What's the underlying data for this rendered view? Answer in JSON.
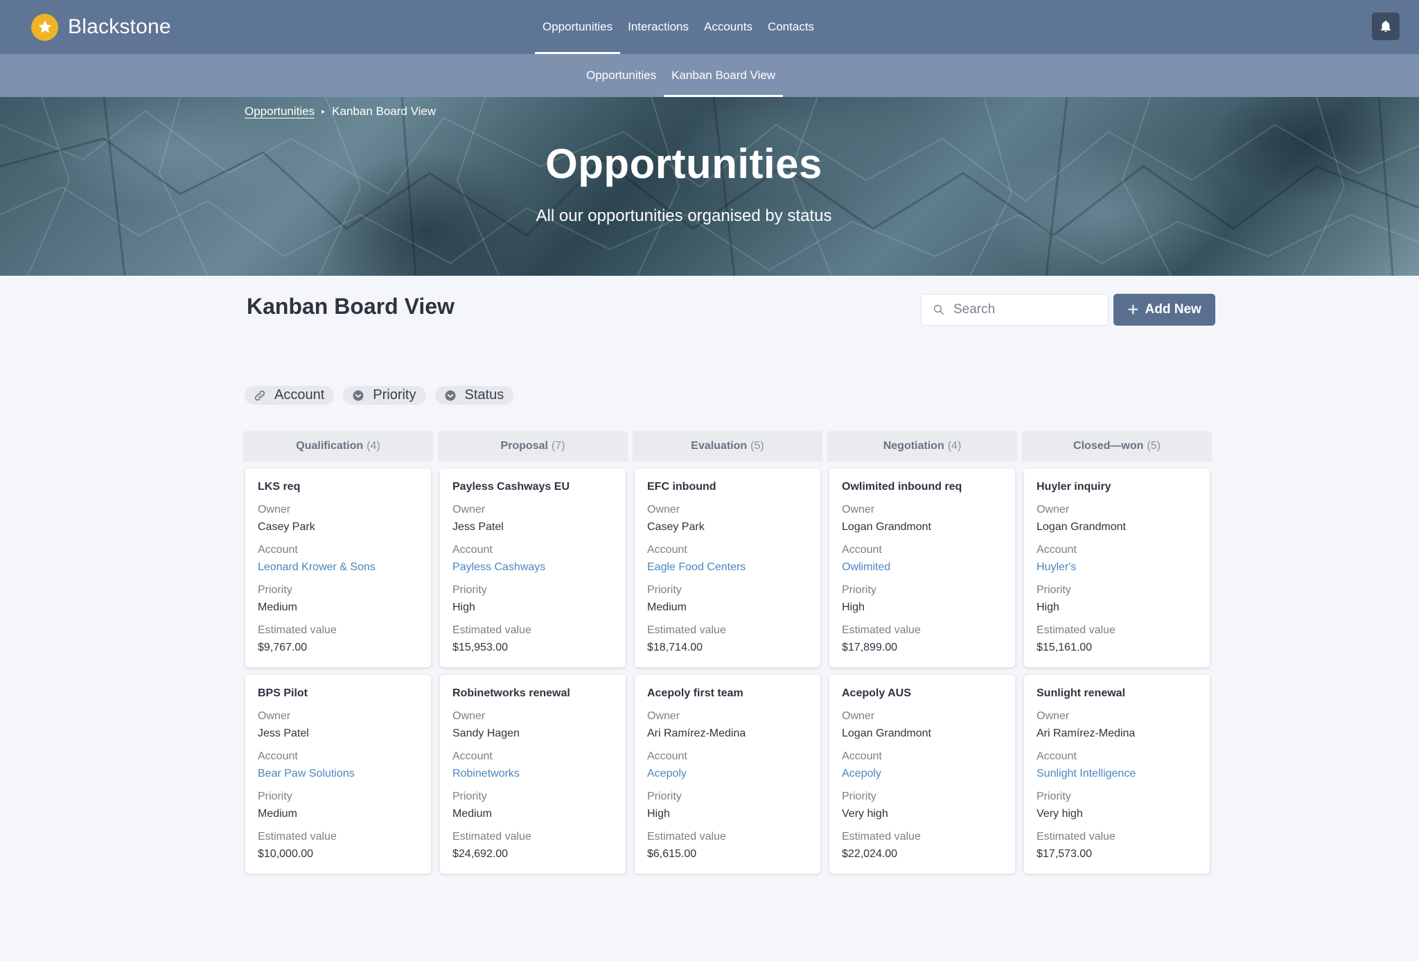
{
  "app": {
    "name": "Blackstone"
  },
  "nav": {
    "items": [
      {
        "label": "Opportunities"
      },
      {
        "label": "Interactions"
      },
      {
        "label": "Accounts"
      },
      {
        "label": "Contacts"
      }
    ],
    "active": "Opportunities"
  },
  "subnav": {
    "items": [
      {
        "label": "Opportunities"
      },
      {
        "label": "Kanban Board View"
      }
    ],
    "active": "Kanban Board View"
  },
  "breadcrumb": {
    "parent": "Opportunities",
    "separator": "▸",
    "current": "Kanban Board View"
  },
  "hero": {
    "title": "Opportunities",
    "subtitle": "All our opportunities organised by status"
  },
  "page": {
    "heading": "Kanban Board View",
    "search_placeholder": "Search",
    "add_button": "Add New"
  },
  "filters": [
    {
      "label": "Account",
      "icon": "link-icon"
    },
    {
      "label": "Priority",
      "icon": "chevron-down-circle-icon"
    },
    {
      "label": "Status",
      "icon": "chevron-down-circle-icon"
    }
  ],
  "labels": {
    "owner": "Owner",
    "account": "Account",
    "priority": "Priority",
    "estimated_value": "Estimated value"
  },
  "columns": [
    {
      "name": "Qualification",
      "count": "(4)",
      "cards": [
        {
          "title": "LKS req",
          "owner": "Casey Park",
          "account": "Leonard Krower & Sons",
          "priority": "Medium",
          "value": "$9,767.00"
        },
        {
          "title": "BPS Pilot",
          "owner": "Jess Patel",
          "account": "Bear Paw Solutions",
          "priority": "Medium",
          "value": "$10,000.00"
        }
      ]
    },
    {
      "name": "Proposal",
      "count": "(7)",
      "cards": [
        {
          "title": "Payless Cashways EU",
          "owner": "Jess Patel",
          "account": "Payless Cashways",
          "priority": "High",
          "value": "$15,953.00"
        },
        {
          "title": "Robinetworks renewal",
          "owner": "Sandy Hagen",
          "account": "Robinetworks",
          "priority": "Medium",
          "value": "$24,692.00"
        }
      ]
    },
    {
      "name": "Evaluation",
      "count": "(5)",
      "cards": [
        {
          "title": "EFC inbound",
          "owner": "Casey Park",
          "account": "Eagle Food Centers",
          "priority": "Medium",
          "value": "$18,714.00"
        },
        {
          "title": "Acepoly first team",
          "owner": "Ari Ramírez-Medina",
          "account": "Acepoly",
          "priority": "High",
          "value": "$6,615.00"
        }
      ]
    },
    {
      "name": "Negotiation",
      "count": "(4)",
      "cards": [
        {
          "title": "Owlimited inbound req",
          "owner": "Logan Grandmont",
          "account": "Owlimited",
          "priority": "High",
          "value": "$17,899.00"
        },
        {
          "title": "Acepoly AUS",
          "owner": "Logan Grandmont",
          "account": "Acepoly",
          "priority": "Very high",
          "value": "$22,024.00"
        }
      ]
    },
    {
      "name": "Closed—won",
      "count": "(5)",
      "cards": [
        {
          "title": "Huyler inquiry",
          "owner": "Logan Grandmont",
          "account": "Huyler's",
          "priority": "High",
          "value": "$15,161.00"
        },
        {
          "title": "Sunlight renewal",
          "owner": "Ari Ramírez-Medina",
          "account": "Sunlight Intelligence",
          "priority": "Very high",
          "value": "$17,573.00"
        }
      ]
    }
  ],
  "colors": {
    "topnav": "#5f7596",
    "subnav": "#7e92b0",
    "accent_button": "#5a6f90",
    "link": "#4a86bf",
    "logo": "#f0b323"
  }
}
